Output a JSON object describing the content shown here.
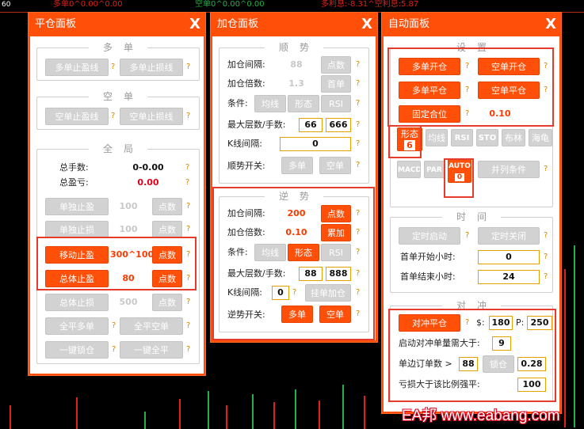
{
  "chart": {
    "corner": "60",
    "long_profit": "多单0^0.00^0.00",
    "short_profit": "空单0^0.00^0.00",
    "long_interest": "多利息:-8.31^空利息:5.87"
  },
  "close_panel": {
    "title": "平仓面板",
    "close": "X",
    "long_group": {
      "title": "多单",
      "tp": "多单止盈线",
      "sl": "多单止损线"
    },
    "short_group": {
      "title": "空单",
      "tp": "空单止盈线",
      "sl": "空单止损线"
    },
    "global_group": {
      "title": "全局",
      "lots_label": "总手数:",
      "lots_value": "0-0.00",
      "profit_label": "总盈亏:",
      "profit_value": "0.00",
      "single_tp": "单独止盈",
      "single_tp_value": "100",
      "single_tp_unit": "点数",
      "single_sl": "单独止损",
      "single_sl_value": "100",
      "single_sl_unit": "点数",
      "trailing": "移动止盈",
      "trailing_value": "300^100",
      "trailing_unit": "点数",
      "total_tp": "总体止盈",
      "total_tp_value": "80",
      "total_tp_unit": "点数",
      "total_sl": "总体止损",
      "total_sl_value": "500",
      "total_sl_unit": "点数",
      "close_all_long": "全平多单",
      "close_all_short": "全平空单",
      "lock": "一键锁仓",
      "close_all": "一键全平"
    }
  },
  "add_panel": {
    "title": "加仓面板",
    "close": "X",
    "trend": {
      "title": "顺势",
      "interval_label": "加仓间隔:",
      "interval_value": "88",
      "interval_unit": "点数",
      "multiplier_label": "加仓倍数:",
      "multiplier_value": "1.3",
      "multiplier_mode": "首单",
      "cond_label": "条件:",
      "cond_ma": "均线",
      "cond_pattern": "形态",
      "cond_rsi": "RSI",
      "max_label": "最大层数/手数:",
      "max_layers": "66",
      "max_lots": "666",
      "kline_label": "K线间隔:",
      "kline_value": "0",
      "switch_label": "顺势开关:",
      "switch_long": "多单",
      "switch_short": "空单"
    },
    "counter": {
      "title": "逆势",
      "interval_label": "加仓间隔:",
      "interval_value": "200",
      "interval_unit": "点数",
      "multiplier_label": "加仓倍数:",
      "multiplier_value": "0.10",
      "multiplier_mode": "累加",
      "cond_label": "条件:",
      "cond_ma": "均线",
      "cond_pattern": "形态",
      "cond_rsi": "RSI",
      "max_label": "最大层数/手数:",
      "max_layers": "88",
      "max_lots": "888",
      "kline_label": "K线间隔:",
      "kline_value": "0",
      "pending": "挂单加仓",
      "switch_label": "逆势开关:",
      "switch_long": "多单",
      "switch_short": "空单"
    }
  },
  "auto_panel": {
    "title": "自动面板",
    "close": "X",
    "settings": {
      "title": "设置",
      "long_open": "多单开仓",
      "short_open": "空单开仓",
      "long_close": "多单平仓",
      "short_close": "空单平仓",
      "fixed_lot": "固定合位",
      "fixed_lot_value": "0.10",
      "pattern": "形态",
      "pattern_value": "6",
      "ma": "均线",
      "rsi": "RSI",
      "sto": "STO",
      "boll": "布林",
      "turtle": "海龟",
      "macd": "MACD",
      "par": "PAR",
      "auto": "AUTO",
      "auto_value": "0",
      "and_cond": "并列条件"
    },
    "time": {
      "title": "时间",
      "timer_start": "定时启动",
      "timer_stop": "定时关闭",
      "start_label": "首单开始小时:",
      "start_value": "0",
      "end_label": "首单结束小时:",
      "end_value": "24"
    },
    "hedge": {
      "title": "对冲",
      "hedge_close": "对冲平仓",
      "dollar_label": "$:",
      "dollar_value": "180",
      "p_label": "P:",
      "p_value": "250",
      "min_orders_label": "启动对冲单量需大于:",
      "min_orders_value": "9",
      "side_label": "单边订单数 >",
      "side_value": "88",
      "lock": "锁仓",
      "lock_value": "0.28",
      "loss_label": "亏损大于该比例强平:",
      "loss_value": "100"
    }
  },
  "watermark": "EA邦 www.eabang.com"
}
